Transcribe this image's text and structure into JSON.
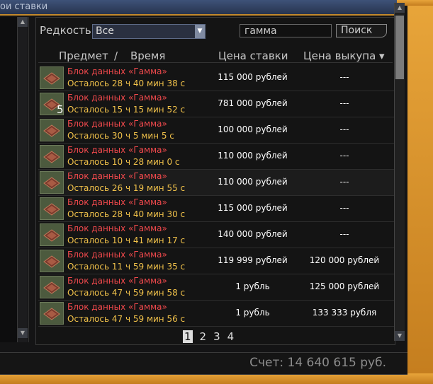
{
  "window": {
    "title": "ои ставки"
  },
  "filter": {
    "rarity_label": "Редкость",
    "rarity_value": "Все",
    "search_value": "гамма",
    "search_button": "Поиск"
  },
  "columns": {
    "item": "Предмет",
    "separator": "/",
    "time": "Время",
    "bid": "Цена ставки",
    "buyout": "Цена выкупа ▾"
  },
  "rows": [
    {
      "name": "Блок данных «Гамма»",
      "time": "Осталось 28 ч 40 мин 38 с",
      "bid": "115 000 рублей",
      "buyout": "---"
    },
    {
      "name": "Блок данных «Гамма»",
      "time": "Осталось 15 ч 15 мин 52 с",
      "bid": "781 000 рублей",
      "buyout": "---"
    },
    {
      "name": "Блок данных «Гамма»",
      "time": "Осталось 30 ч 5 мин 5 с",
      "bid": "100 000 рублей",
      "buyout": "---"
    },
    {
      "name": "Блок данных «Гамма»",
      "time": "Осталось 10 ч 28 мин 0 с",
      "bid": "110 000 рублей",
      "buyout": "---"
    },
    {
      "name": "Блок данных «Гамма»",
      "time": "Осталось 26 ч 19 мин 55 с",
      "bid": "110 000 рублей",
      "buyout": "---"
    },
    {
      "name": "Блок данных «Гамма»",
      "time": "Осталось 28 ч 40 мин 30 с",
      "bid": "115 000 рублей",
      "buyout": "---"
    },
    {
      "name": "Блок данных «Гамма»",
      "time": "Осталось 10 ч 41 мин 17 с",
      "bid": "140 000 рублей",
      "buyout": "---"
    },
    {
      "name": "Блок данных «Гамма»",
      "time": "Осталось 11 ч 59 мин 35 с",
      "bid": "119 999 рублей",
      "buyout": "120 000 рублей"
    },
    {
      "name": "Блок данных «Гамма»",
      "time": "Осталось 47 ч 59 мин 58 с",
      "bid": "1 рубль",
      "buyout": "125 000 рублей"
    },
    {
      "name": "Блок данных «Гамма»",
      "time": "Осталось 47 ч 59 мин 56 с",
      "bid": "1 рубль",
      "buyout": "133 333 рубля"
    }
  ],
  "stack_count": "5",
  "pages": [
    "1",
    "2",
    "3",
    "4"
  ],
  "current_page": "1",
  "footer": {
    "balance": "Счет: 14 640 615 руб."
  },
  "icons": [
    "data-block-icon",
    "dropdown-arrow-icon",
    "scroll-up-icon",
    "scroll-down-icon"
  ]
}
